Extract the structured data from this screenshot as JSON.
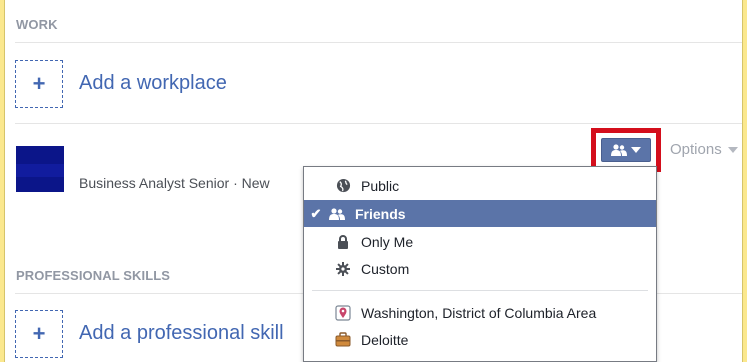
{
  "work": {
    "heading": "WORK",
    "add_workplace_label": "Add a workplace",
    "job_title": "Business Analyst Senior · New",
    "options_label": "Options"
  },
  "privacy_menu": {
    "items": [
      {
        "label": "Public",
        "icon": "globe-icon",
        "selected": false
      },
      {
        "label": "Friends",
        "icon": "friends-icon",
        "selected": true
      },
      {
        "label": "Only Me",
        "icon": "lock-icon",
        "selected": false
      },
      {
        "label": "Custom",
        "icon": "gear-icon",
        "selected": false
      }
    ],
    "lists": [
      {
        "label": "Washington, District of Columbia Area",
        "icon": "location-icon"
      },
      {
        "label": "Deloitte",
        "icon": "briefcase-icon"
      }
    ]
  },
  "skills": {
    "heading": "PROFESSIONAL SKILLS",
    "add_skill_label": "Add a professional skill"
  },
  "colors": {
    "accent": "#4267b2",
    "selected_bg": "#5b74a8",
    "highlight_border": "#d40e1c",
    "page_bg": "#fbe88e"
  }
}
